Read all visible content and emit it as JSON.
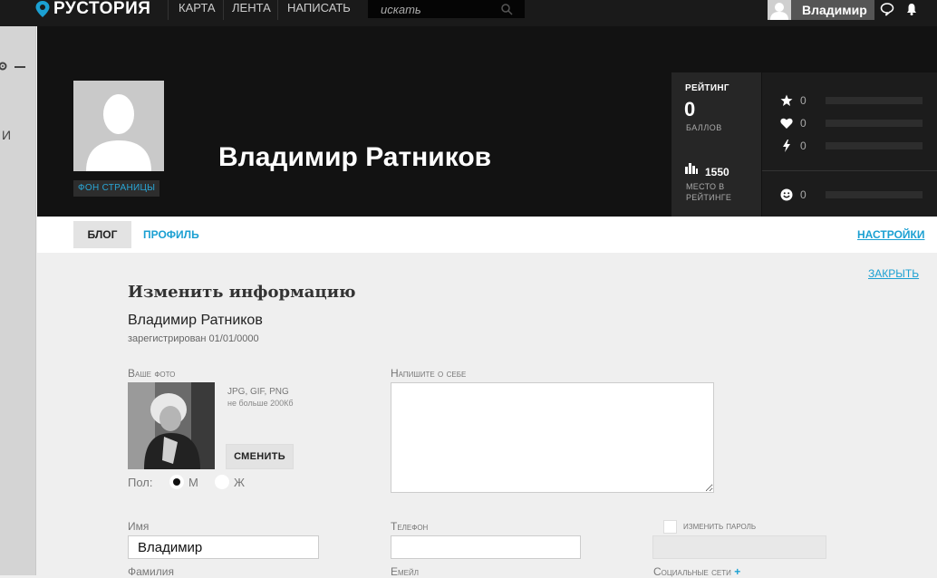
{
  "topnav": {
    "logo": "РУСТОРИЯ",
    "items": [
      "КАРТА",
      "ЛЕНТА",
      "НАПИСАТЬ"
    ],
    "search_placeholder": "искать",
    "user_name": "Владимир"
  },
  "leftrail": {
    "letter": "И"
  },
  "header": {
    "bg_link": "ФОН СТРАНИЦЫ",
    "name": "Владимир Ратников",
    "rating": {
      "title": "РЕЙТИНГ",
      "value": "0",
      "unit": "БАЛЛОВ",
      "place": "1550",
      "place_label": "МЕСТО В РЕЙТИНГЕ"
    },
    "stats": [
      {
        "icon": "star-icon",
        "value": "0"
      },
      {
        "icon": "heart-icon",
        "value": "0"
      },
      {
        "icon": "lightning-icon",
        "value": "0"
      },
      {
        "icon": "smiley-icon",
        "value": "0"
      }
    ]
  },
  "tabs": {
    "blog": "БЛОГ",
    "profile": "ПРОФИЛЬ",
    "settings": "НАСТРОЙКИ"
  },
  "form": {
    "close": "ЗАКРЫТЬ",
    "title": "Изменить информацию",
    "full_name": "Владимир Ратников",
    "registered": "зарегистрирован 01/01/0000",
    "photo_label": "Ваше фото",
    "photo_types": "JPG, GIF, PNG",
    "photo_size": "не больше 200Кб",
    "change_button": "СМЕНИТЬ",
    "about_label": "Напишите о себе",
    "about_value": "",
    "gender_label": "Пол:",
    "gender_m": "М",
    "gender_f": "Ж",
    "gender_selected": "М",
    "first_name_label": "Имя",
    "first_name_value": "Владимир",
    "phone_label": "Телефон",
    "phone_value": "",
    "change_password_label": "изменить пароль",
    "last_name_label": "Фамилия",
    "email_label": "Емейл",
    "social_label": "Социальные сети"
  }
}
